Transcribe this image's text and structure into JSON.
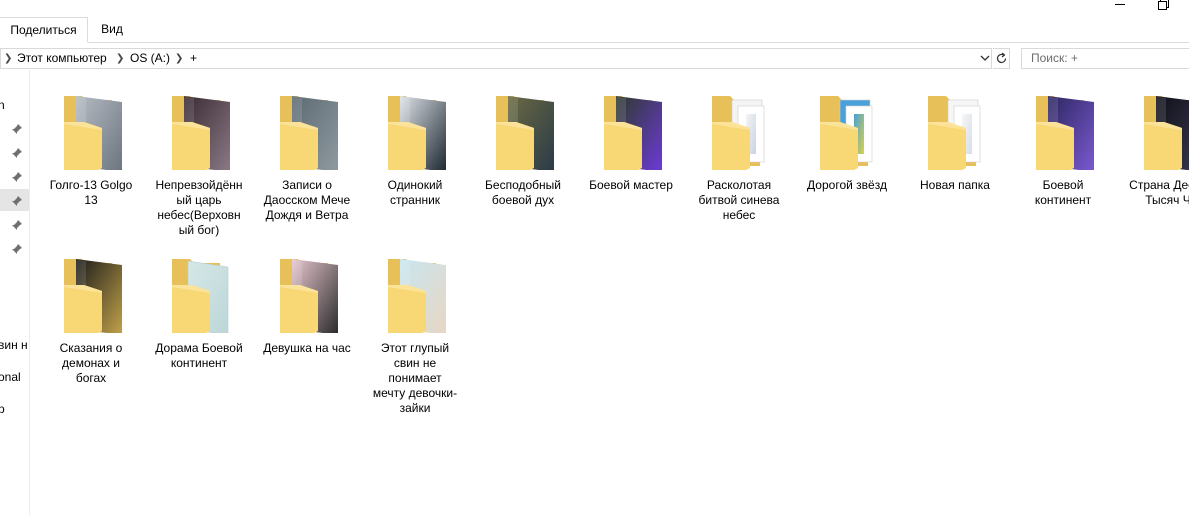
{
  "ribbon": {
    "tabs": [
      {
        "label": "Поделиться",
        "active": true
      },
      {
        "label": "Вид",
        "active": false
      }
    ]
  },
  "address": {
    "segments": [
      "Этот компьютер",
      "OS (A:)",
      "+"
    ]
  },
  "search": {
    "placeholder": "Поиск: +"
  },
  "nav": {
    "visible_fragments": [
      "n",
      "вин н",
      "onal",
      "p"
    ]
  },
  "folders": [
    {
      "name": "Голго-13  Golgo 13",
      "cover": [
        "#b6bcc4",
        "#6c747f"
      ],
      "style": "tall"
    },
    {
      "name": "Непревзойдённый царь небес(Верховный бог)",
      "cover": [
        "#3a2a32",
        "#8a7a86"
      ],
      "style": "tall"
    },
    {
      "name": "Записи о Даосском Мече Дождя и Ветра",
      "cover": [
        "#5c6a72",
        "#8f9aa0"
      ],
      "style": "tall"
    },
    {
      "name": "Одинокий странник",
      "cover": [
        "#dfe4ea",
        "#1e2830"
      ],
      "style": "tall"
    },
    {
      "name": "Бесподобный боевой дух",
      "cover": [
        "#6b6a42",
        "#2a3a48"
      ],
      "style": "tall"
    },
    {
      "name": "Боевой мастер",
      "cover": [
        "#2e3a2c",
        "#6c3ad8"
      ],
      "style": "tall"
    },
    {
      "name": "Расколотая битвой синева небес",
      "cover": [
        "#f4f4f4",
        "#c8d4e4"
      ],
      "style": "doc"
    },
    {
      "name": "Дорогой звёзд",
      "cover": [
        "#4aa0d8",
        "#d8d24a"
      ],
      "style": "doc"
    },
    {
      "name": "Новая папка",
      "cover": [
        "#f6f6f6",
        "#d6dee8"
      ],
      "style": "doc"
    },
    {
      "name": "Боевой континент",
      "cover": [
        "#2c2660",
        "#7a5ad0"
      ],
      "style": "tall"
    },
    {
      "name": "Страна Десяти Тысяч Чу",
      "cover": [
        "#10101a",
        "#3a3a50"
      ],
      "style": "tall"
    },
    {
      "name": "Сказания о демонах и богах",
      "cover": [
        "#1a1a1a",
        "#c2a24a"
      ],
      "style": "tall"
    },
    {
      "name": "Дорама Боевой континент",
      "cover": [
        "#d6e8e8",
        "#bcd6d8"
      ],
      "style": "plain"
    },
    {
      "name": "Девушка на час",
      "cover": [
        "#e8c8d0",
        "#2a2a2a"
      ],
      "style": "tall"
    },
    {
      "name": "Этот глупый свин не понимает мечту девочки-зайки",
      "cover": [
        "#c8e6f0",
        "#e8d6c4"
      ],
      "style": "tall"
    }
  ]
}
